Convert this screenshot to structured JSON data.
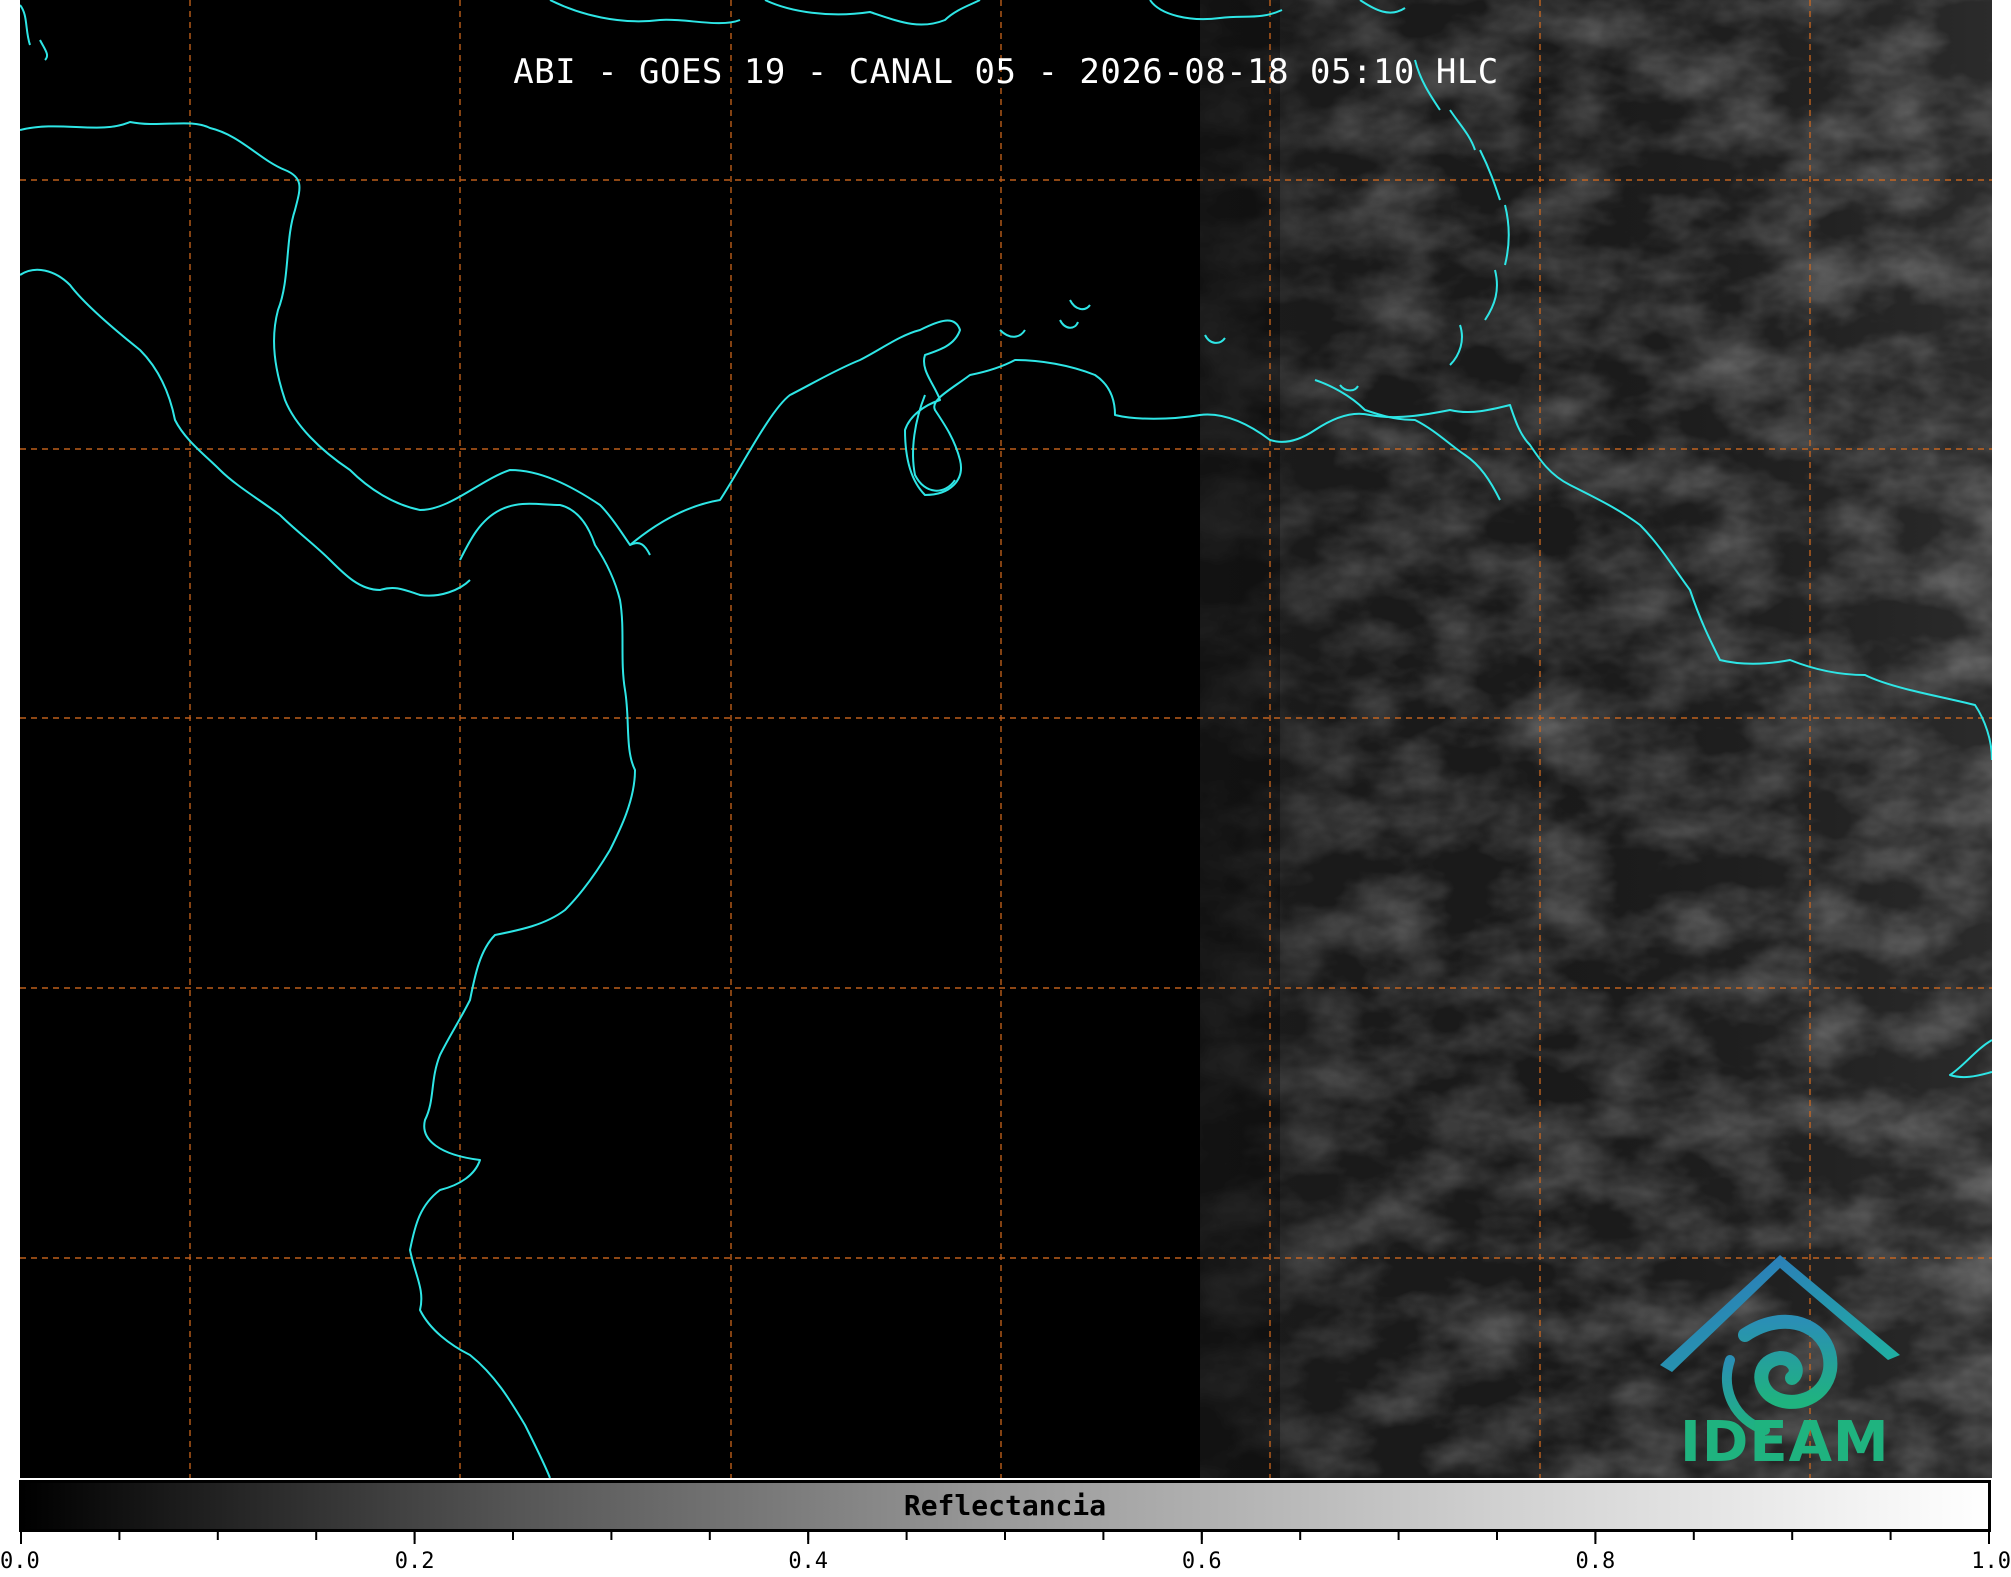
{
  "title": "ABI - GOES 19 - CANAL 05 - 2026-08-18 05:10 HLC",
  "logo": {
    "text": "IDEAM",
    "icon": "ideam-logo-icon",
    "colors": {
      "roof": "#2f6fc0",
      "swirl": "#1fb37f"
    }
  },
  "colorbar": {
    "label": "Reflectancia",
    "range": [
      0.0,
      1.0
    ],
    "ticks": [
      "0.0",
      "0.2",
      "0.4",
      "0.6",
      "0.8",
      "1.0"
    ],
    "colormap": "grayscale"
  },
  "map": {
    "coastline_color": "#2ee6e6",
    "gridline_color": "#d2691e",
    "gridline_style": "dashed"
  }
}
